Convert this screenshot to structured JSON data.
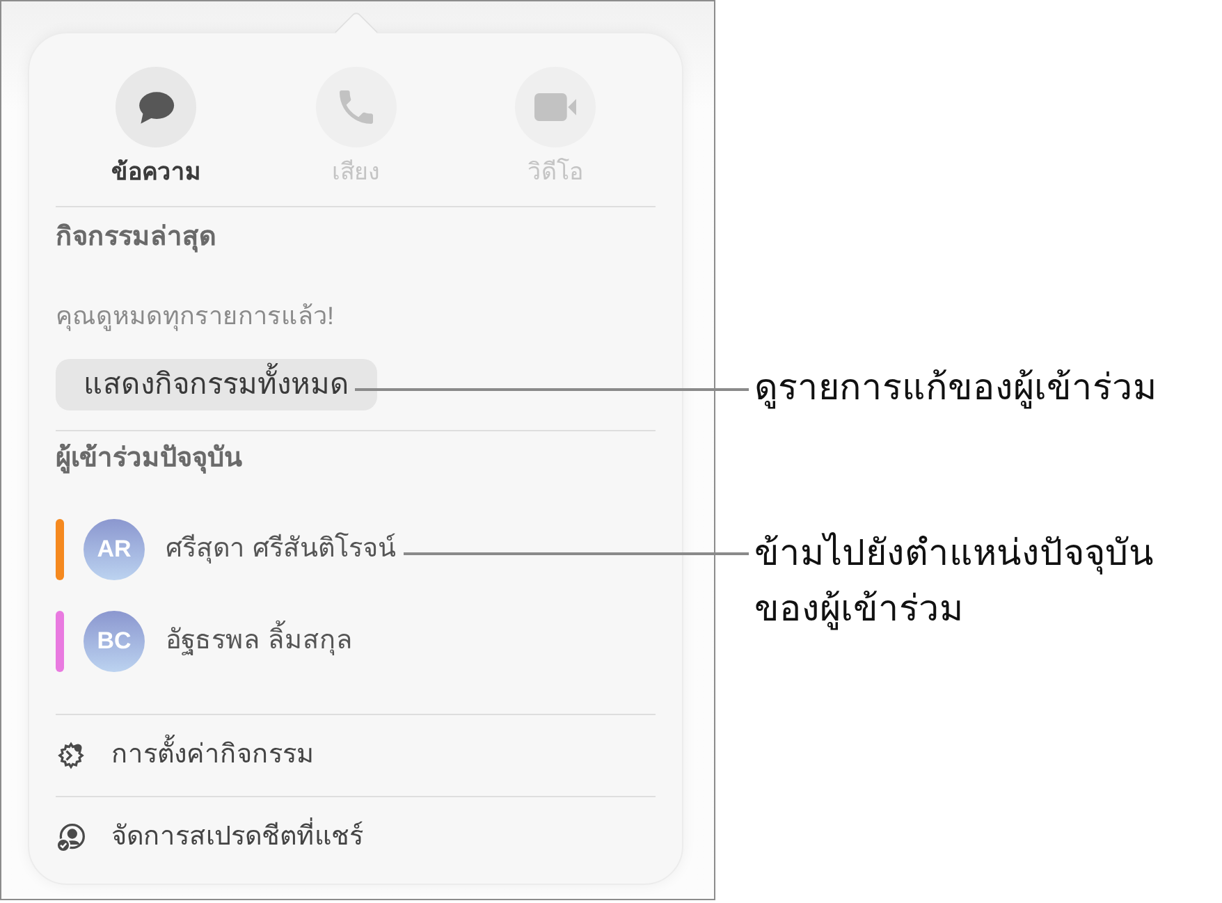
{
  "actions": [
    {
      "kind": "message",
      "label": "ข้อความ",
      "disabled": false
    },
    {
      "kind": "audio",
      "label": "เสียง",
      "disabled": true
    },
    {
      "kind": "video",
      "label": "วิดีโอ",
      "disabled": true
    }
  ],
  "recent_activity": {
    "heading": "กิจกรรมล่าสุด",
    "message": "คุณดูหมดทุกรายการแล้ว!",
    "button": "แสดงกิจกรรมทั้งหมด"
  },
  "participants": {
    "heading": "ผู้เข้าร่วมปัจจุบัน",
    "items": [
      {
        "initials": "AR",
        "name": "ศรีสุดา ศรีสันติโรจน์",
        "color": "#f5891f"
      },
      {
        "initials": "BC",
        "name": "อัฐธรพล ลิ้มสกุล",
        "color": "#e97ae0"
      }
    ]
  },
  "menu": [
    {
      "kind": "settings",
      "label": "การตั้งค่ากิจกรรม"
    },
    {
      "kind": "share",
      "label": "จัดการสเปรดชีตที่แชร์"
    }
  ],
  "callouts": [
    {
      "text": "ดูรายการแก้ของผู้เข้าร่วม"
    },
    {
      "text": "ข้ามไปยังตำแหน่งปัจจุบันของผู้เข้าร่วม"
    }
  ]
}
